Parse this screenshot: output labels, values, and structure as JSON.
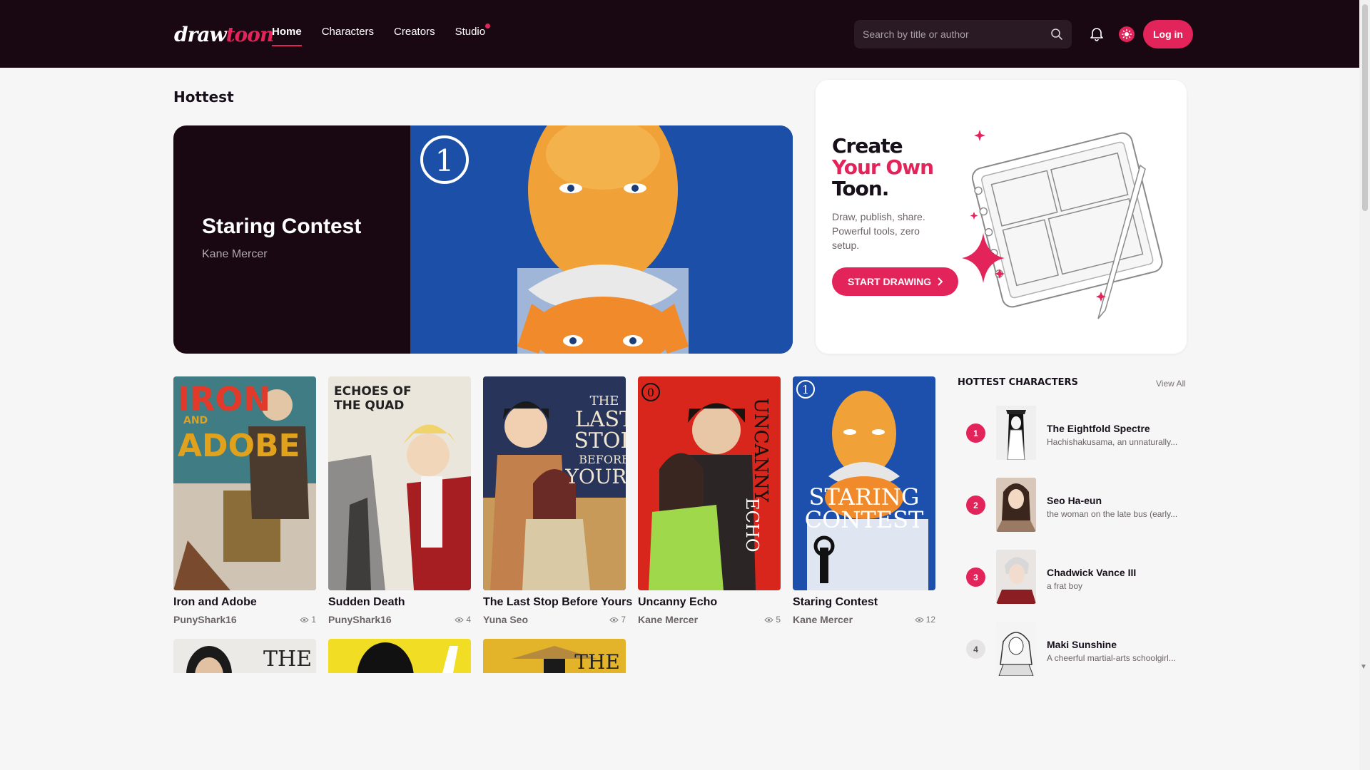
{
  "nav": {
    "logo_a": "draw",
    "logo_b": "toon",
    "links": [
      {
        "label": "Home"
      },
      {
        "label": "Characters"
      },
      {
        "label": "Creators"
      },
      {
        "label": "Studio"
      }
    ],
    "search_placeholder": "Search by title or author",
    "login": "Log in"
  },
  "hottest": {
    "heading": "Hottest",
    "hero": {
      "title": "Staring Contest",
      "author": "Kane Mercer"
    }
  },
  "promo": {
    "line1": "Create",
    "line2": "Your Own",
    "line3": "Toon.",
    "body": "Draw, publish, share. Powerful tools, zero setup.",
    "button": "START DRAWING"
  },
  "comics": [
    {
      "title": "Iron and Adobe",
      "author": "PunyShark16",
      "views": "1"
    },
    {
      "title": "Sudden Death",
      "author": "PunyShark16",
      "views": "4"
    },
    {
      "title": "The Last Stop Before Yours",
      "author": "Yuna Seo",
      "views": "7"
    },
    {
      "title": "Uncanny Echo",
      "author": "Kane Mercer",
      "views": "5"
    },
    {
      "title": "Staring Contest",
      "author": "Kane Mercer",
      "views": "12"
    }
  ],
  "covers": {
    "iron": [
      "IRON",
      "AND",
      "ADOBE"
    ],
    "sudden": [
      "ECHOES OF",
      "THE QUAD"
    ],
    "last": [
      "THE",
      "LAST",
      "STOP",
      "BEFORE",
      "YOURS"
    ],
    "uncanny": [
      "UNCANNY",
      "ECHO"
    ],
    "staring": [
      "STARING",
      "CONTEST"
    ]
  },
  "characters": {
    "heading": "HOTTEST CHARACTERS",
    "view_all": "View All",
    "items": [
      {
        "rank": "1",
        "name": "The Eightfold Spectre",
        "desc": "Hachishakusama, an unnaturally..."
      },
      {
        "rank": "2",
        "name": "Seo Ha-eun",
        "desc": "the woman on the late bus (early..."
      },
      {
        "rank": "3",
        "name": "Chadwick Vance III",
        "desc": "a frat boy"
      },
      {
        "rank": "4",
        "name": "Maki Sunshine",
        "desc": "A cheerful martial-arts schoolgirl..."
      }
    ]
  },
  "colors": {
    "brand": "#e3245a",
    "dark": "#190812"
  }
}
